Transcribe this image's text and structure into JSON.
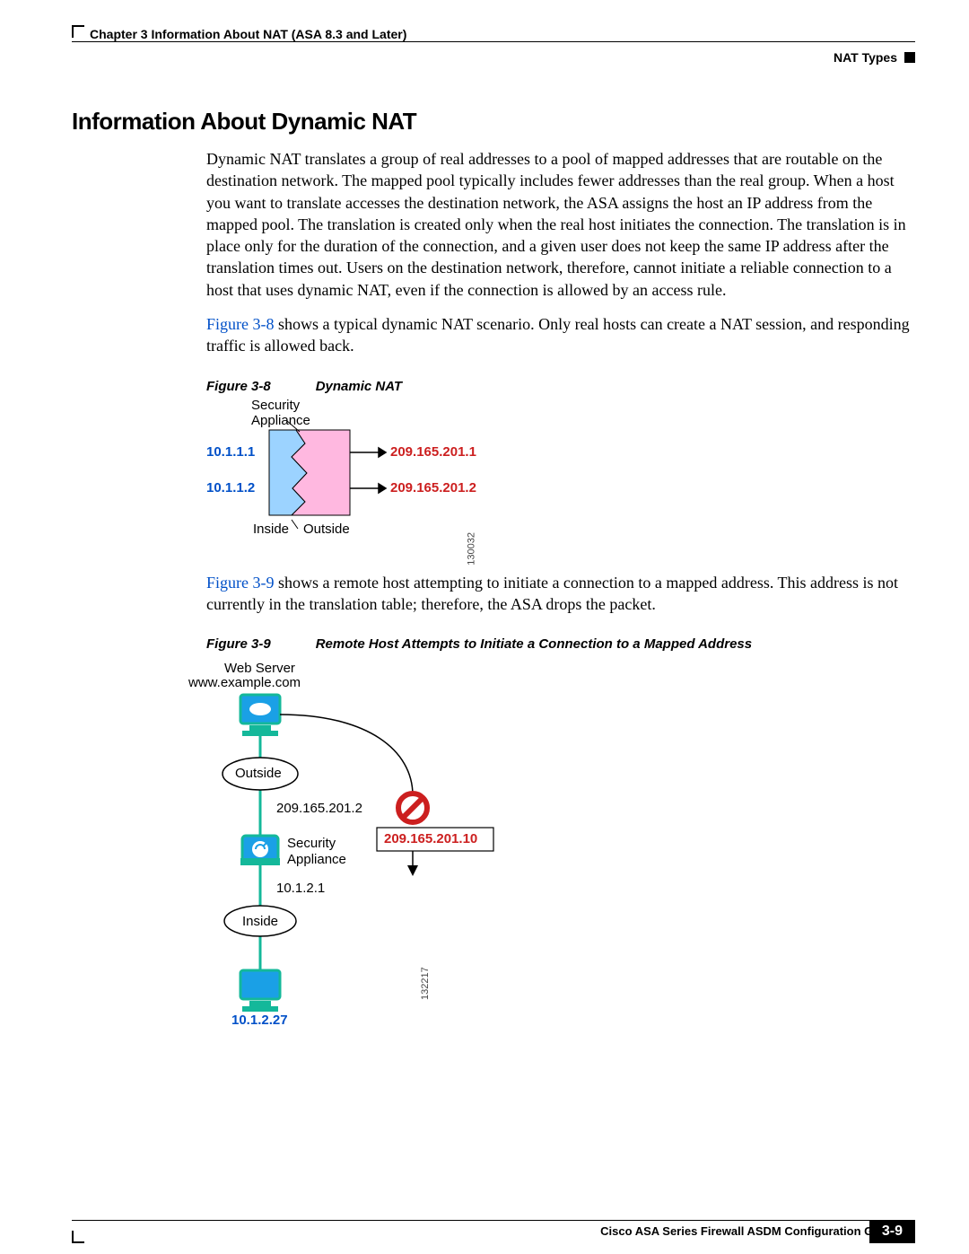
{
  "header": {
    "chapter": "Chapter 3      Information About NAT (ASA 8.3 and Later)",
    "section_right": "NAT Types"
  },
  "section_title": "Information About Dynamic NAT",
  "para1": "Dynamic NAT translates a group of real addresses to a pool of mapped addresses that are routable on the destination network. The mapped pool typically includes fewer addresses than the real group. When a host you want to translate accesses the destination network, the ASA assigns the host an IP address from the mapped pool. The translation is created only when the real host initiates the connection. The translation is in place only for the duration of the connection, and a given user does not keep the same IP address after the translation times out. Users on the destination network, therefore, cannot initiate a reliable connection to a host that uses dynamic NAT, even if the connection is allowed by an access rule.",
  "para2_link": "Figure 3-8",
  "para2_rest": " shows a typical dynamic NAT scenario. Only real hosts can create a NAT session, and responding traffic is allowed back.",
  "fig8": {
    "label": "Figure 3-8",
    "title": "Dynamic NAT",
    "security_appliance": "Security\nAppliance",
    "ip_left_1": "10.1.1.1",
    "ip_left_2": "10.1.1.2",
    "ip_right_1": "209.165.201.1",
    "ip_right_2": "209.165.201.2",
    "inside": "Inside",
    "outside": "Outside",
    "image_id": "130032"
  },
  "para3_link": "Figure 3-9",
  "para3_rest": " shows a remote host attempting to initiate a connection to a mapped address. This address is not currently in the translation table; therefore, the ASA drops the packet.",
  "fig9": {
    "label": "Figure 3-9",
    "title": "Remote Host Attempts to Initiate a Connection to a Mapped Address",
    "web_server": "Web Server",
    "web_url": "www.example.com",
    "outside": "Outside",
    "ip_outside": "209.165.201.2",
    "security_appliance": "Security\nAppliance",
    "ip_mapped": "209.165.201.10",
    "ip_sa_inside": "10.1.2.1",
    "inside": "Inside",
    "ip_host": "10.1.2.27",
    "image_id": "132217"
  },
  "footer": {
    "guide": "Cisco ASA Series Firewall ASDM Configuration Guide",
    "page": "3-9"
  }
}
